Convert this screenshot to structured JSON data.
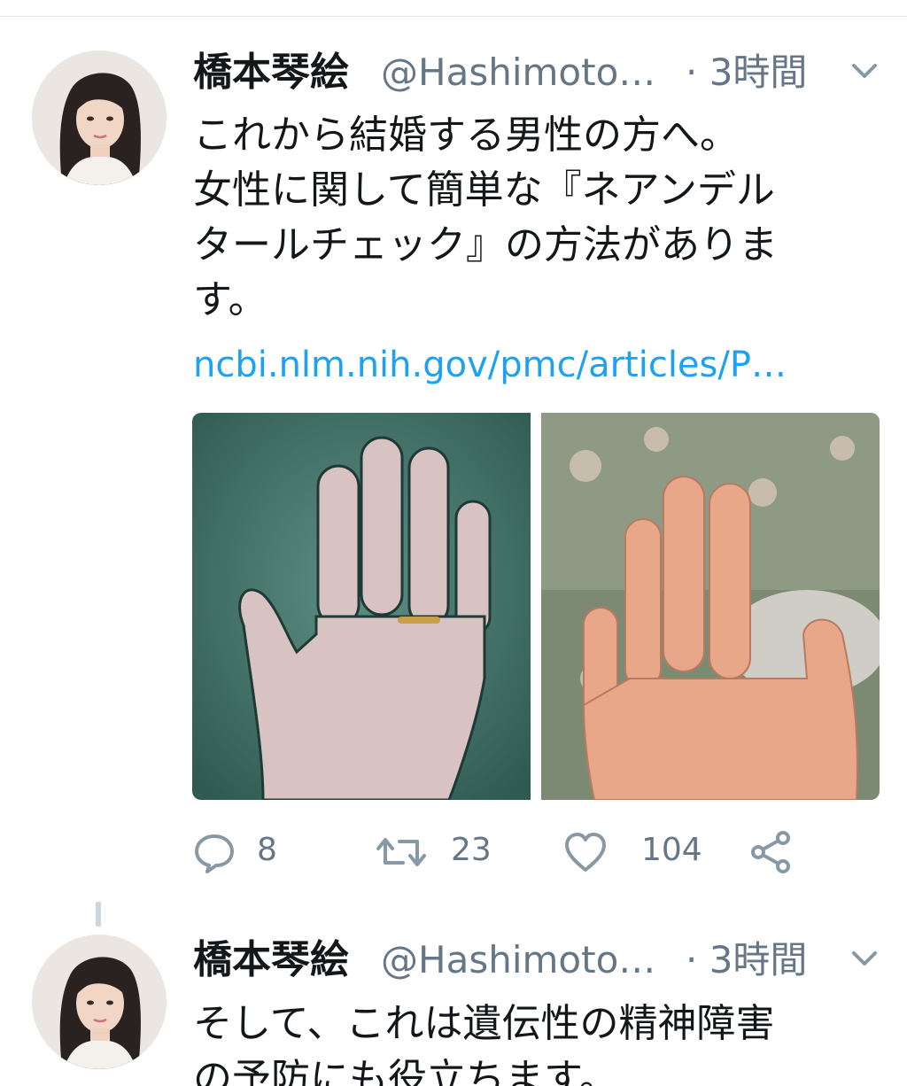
{
  "tweets": [
    {
      "display_name": "橋本琴絵",
      "handle": "@Hashimoto…",
      "time": "· 3時間",
      "text_lines": [
        "これから結婚する男性の方へ。",
        "女性に関して簡単な『ネアンデル",
        "タールチェック』の方法がありま",
        "す。"
      ],
      "link": "ncbi.nlm.nih.gov/pmc/articles/P…",
      "counts": {
        "reply": "8",
        "retweet": "23",
        "like": "104"
      }
    },
    {
      "display_name": "橋本琴絵",
      "handle": "@Hashimoto…",
      "time": "· 3時間",
      "text_lines": [
        "そして、これは遺伝性の精神障害",
        "の予防にも役立ちます。"
      ]
    }
  ],
  "icons": {
    "reply": "reply-icon",
    "retweet": "retweet-icon",
    "like": "heart-icon",
    "share": "share-icon",
    "caret": "chevron-down-icon"
  },
  "colors": {
    "text": "#14171a",
    "secondary": "#657786",
    "link": "#1da1f2",
    "divider": "#e1e8ed"
  }
}
